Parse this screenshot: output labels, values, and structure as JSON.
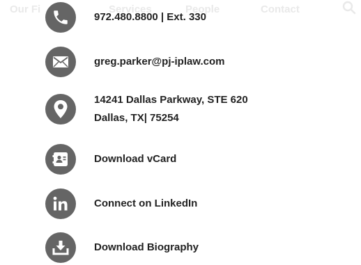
{
  "nav": {
    "items": [
      "Our Fi",
      "Services",
      "People",
      "Contact"
    ],
    "search_icon": "search-icon"
  },
  "contact": {
    "phone": "972.480.8800 | Ext. 330",
    "email": "greg.parker@pj-iplaw.com",
    "address_line1": "14241 Dallas Parkway, STE 620",
    "address_line2": "Dallas, TX| 75254",
    "vcard": "Download vCard",
    "linkedin": "Connect on LinkedIn",
    "biography": "Download Biography"
  },
  "icons": [
    "phone-icon",
    "envelope-icon",
    "location-pin-icon",
    "vcard-icon",
    "linkedin-icon",
    "download-icon"
  ],
  "colors": {
    "icon_bg": "#656565",
    "text": "#222222",
    "nav_faded": "#e9e9e9"
  }
}
